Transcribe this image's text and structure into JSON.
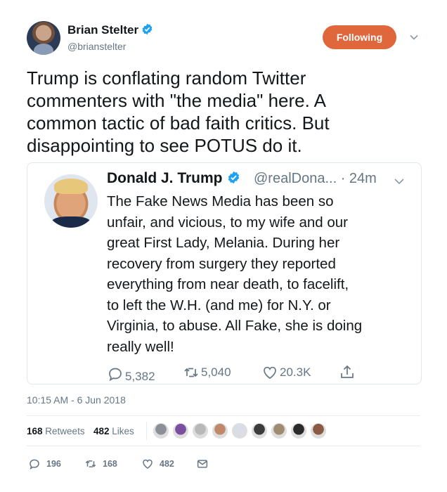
{
  "tweet": {
    "author_name": "Brian Stelter",
    "author_handle": "@brianstelter",
    "follow_label": "Following",
    "text": "Trump is conflating random Twitter\ncommenters with \"the media\" here. A\ncommon tactic of bad faith critics. But\ndisappointing to see POTUS do it.",
    "timestamp": "10:15 AM - 6 Jun 2018"
  },
  "quoted": {
    "name": "Donald J. Trump",
    "handle_time": "@realDona... · 24m",
    "text": "The Fake News Media has been so\nunfair, and vicious, to my wife and our\ngreat First Lady, Melania. During her\nrecovery from surgery they reported\neverything from near death, to facelift,\nto left the W.H. (and me) for N.Y. or\nVirginia, to abuse. All Fake, she is doing\nreally well!",
    "replies": "5,382",
    "retweets": "5,040",
    "likes": "20.3K"
  },
  "stats": {
    "retweets_count": "168",
    "retweets_label": "Retweets",
    "likes_count": "482",
    "likes_label": "Likes"
  },
  "liker_avatar_colors": [
    "#8c8f96",
    "#7b4fa0",
    "#b8b8b8",
    "#c08a6a",
    "#d9dde6",
    "#3c3c3c",
    "#a08a70",
    "#2b2b2b",
    "#8a5a44"
  ],
  "actions": {
    "replies": "196",
    "retweets": "168",
    "likes": "482"
  },
  "colors": {
    "accent": "#e0673b",
    "verified": "#1da1f2",
    "secondary_text": "#657786"
  },
  "icons": [
    "verified-badge-icon",
    "chevron-down-icon",
    "reply-icon",
    "retweet-icon",
    "like-icon",
    "share-icon",
    "direct-message-icon"
  ]
}
